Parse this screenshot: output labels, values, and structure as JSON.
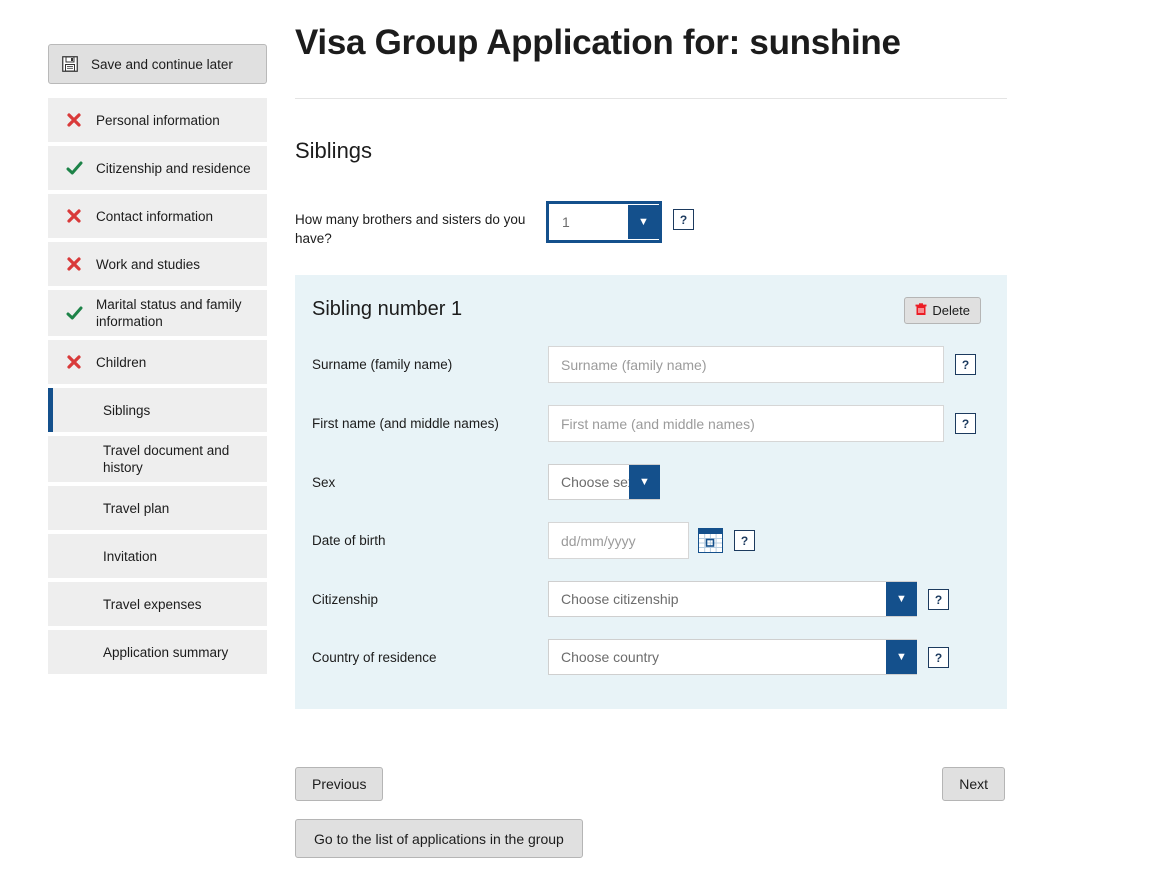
{
  "sidebar": {
    "save_button": {
      "label": "Save and continue later",
      "icon": "save-floppy-icon"
    },
    "items": [
      {
        "label": "Personal information",
        "status": "error",
        "active": false
      },
      {
        "label": "Citizenship and residence",
        "status": "ok",
        "active": false
      },
      {
        "label": "Contact information",
        "status": "error",
        "active": false
      },
      {
        "label": "Work and studies",
        "status": "error",
        "active": false
      },
      {
        "label": "Marital status and family information",
        "status": "ok",
        "active": false
      },
      {
        "label": "Children",
        "status": "error",
        "active": false
      },
      {
        "label": "Siblings",
        "status": "none",
        "active": true
      },
      {
        "label": "Travel document and history",
        "status": "none",
        "active": false
      },
      {
        "label": "Travel plan",
        "status": "none",
        "active": false
      },
      {
        "label": "Invitation",
        "status": "none",
        "active": false
      },
      {
        "label": "Travel expenses",
        "status": "none",
        "active": false
      },
      {
        "label": "Application summary",
        "status": "none",
        "active": false
      }
    ]
  },
  "header": {
    "title": "Visa Group Application for: sunshine"
  },
  "main": {
    "section_title": "Siblings",
    "count_question": {
      "label": "How many brothers and sisters do you have?",
      "value": "1",
      "help_label": "?"
    },
    "sibling_panel": {
      "title": "Sibling number 1",
      "delete_label": "Delete",
      "delete_icon": "trash-icon",
      "fields": [
        {
          "label": "Surname (family name)",
          "placeholder": "Surname (family name)",
          "value": "",
          "type": "text",
          "help_label": "?"
        },
        {
          "label": "First name (and middle names)",
          "placeholder": "First name (and middle names)",
          "value": "",
          "type": "text",
          "help_label": "?"
        },
        {
          "label": "Sex",
          "value": "Choose sex",
          "type": "select-small",
          "help_label": ""
        },
        {
          "label": "Date of birth",
          "placeholder": "dd/mm/yyyy",
          "value": "",
          "type": "date",
          "help_label": "?",
          "calendar_icon": "calendar-icon"
        },
        {
          "label": "Citizenship",
          "value": "Choose citizenship",
          "type": "select-wide",
          "help_label": "?"
        },
        {
          "label": "Country of residence",
          "value": "Choose country",
          "type": "select-wide",
          "help_label": "?"
        }
      ]
    }
  },
  "footer": {
    "previous_label": "Previous",
    "next_label": "Next",
    "group_list_label": "Go to the list of applications in the group"
  },
  "colors": {
    "accent_blue": "#14508c",
    "panel_bg": "#e8f3f7",
    "status_ok": "#1d8348",
    "status_error": "#d93a3a",
    "button_bg": "#e0e0e0"
  }
}
